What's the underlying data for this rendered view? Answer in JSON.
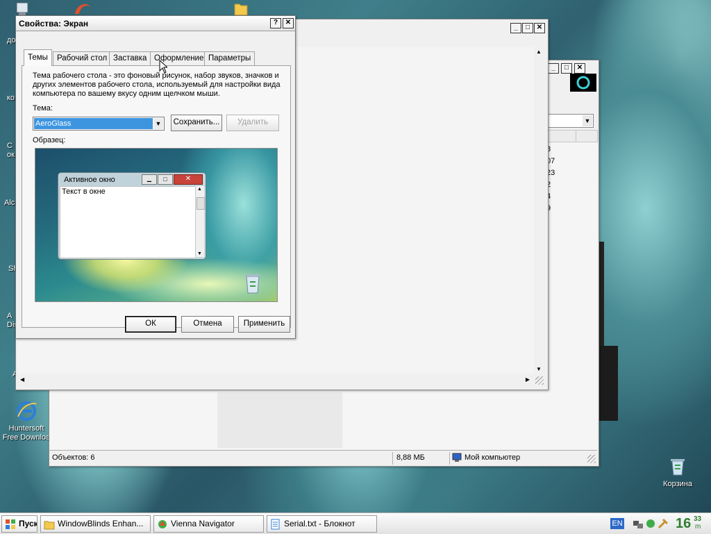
{
  "desktop": {
    "icons": [
      {
        "label": "Huntersoft\nFree Downloa"
      },
      {
        "label": "Корзина"
      }
    ],
    "edge_labels": [
      "до",
      "ко",
      "С\nок",
      "Alc",
      "Sh",
      "A\nDis",
      "A"
    ]
  },
  "explorer_right": {
    "statusbar": {
      "objects": "Объектов: 6",
      "size": "8,88 МБ",
      "location": "Мой компьютер"
    },
    "partial_values": [
      "8",
      "07",
      "23",
      "2",
      "4",
      "9"
    ]
  },
  "dialog": {
    "title": "Свойства: Экран",
    "tabs": [
      "Темы",
      "Рабочий стол",
      "Заставка",
      "Оформление",
      "Параметры"
    ],
    "active_tab": "Темы",
    "description": "Тема рабочего стола - это фоновый рисунок, набор звуков, значков и других элементов рабочего стола, используемый для настройки вида компьютера по вашему вкусу одним щелчком мыши.",
    "theme_label": "Тема:",
    "theme_value": "AeroGlass",
    "save_button": "Сохранить...",
    "delete_button": "Удалить",
    "sample_label": "Образец:",
    "preview": {
      "window_title": "Активное окно",
      "window_text": "Текст в окне"
    },
    "ok_button": "ОК",
    "cancel_button": "Отмена",
    "apply_button": "Применить"
  },
  "taskbar": {
    "start_label": "Пуск",
    "tasks": [
      "WindowBlinds Enhan...",
      "Vienna Navigator",
      "Serial.txt - Блокнот"
    ],
    "language": "EN",
    "clock_hour": "16",
    "clock_minute": "33",
    "clock_ampm": "m"
  },
  "colors": {
    "selection": "#3d95e0",
    "close_red": "#c8443a"
  }
}
